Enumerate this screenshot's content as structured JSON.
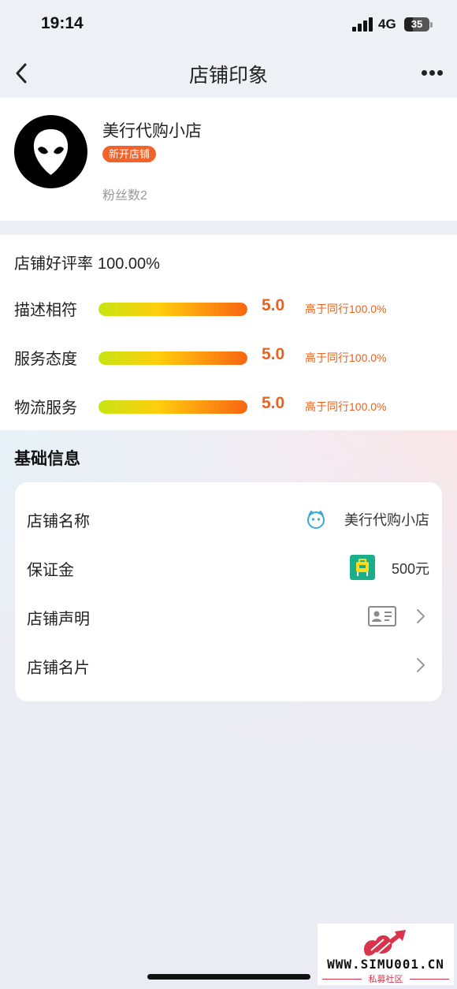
{
  "status_bar": {
    "time": "19:14",
    "network": "4G",
    "battery": "35",
    "battery_level": 0.35
  },
  "nav": {
    "title": "店铺印象",
    "back_icon": "chevron-left-icon",
    "more_icon": "more-dots-icon"
  },
  "shop": {
    "name": "美行代购小店",
    "badge": "新开店铺",
    "fans": "粉丝数2",
    "avatar_icon": "alien-head-icon"
  },
  "rating": {
    "label": "店铺好评率",
    "value": "100.00%",
    "metrics": [
      {
        "label": "描述相符",
        "score": "5.0",
        "compare": "高于同行100.0%",
        "fill": 1.0
      },
      {
        "label": "服务态度",
        "score": "5.0",
        "compare": "高于同行100.0%",
        "fill": 1.0
      },
      {
        "label": "物流服务",
        "score": "5.0",
        "compare": "高于同行100.0%",
        "fill": 1.0
      }
    ]
  },
  "basic_info": {
    "title": "基础信息",
    "rows": [
      {
        "label": "店铺名称",
        "value": "美行代购小店",
        "icon": "smiley-face-icon"
      },
      {
        "label": "保证金",
        "value": "500元",
        "icon": "deposit-bag-icon"
      },
      {
        "label": "店铺声明",
        "icon": "id-card-icon",
        "chevron": "chevron-right-icon"
      },
      {
        "label": "店铺名片",
        "chevron": "chevron-right-icon"
      }
    ]
  },
  "watermark": {
    "text": "WWW.SIMU001.CN",
    "subtext": "私募社区"
  },
  "colors": {
    "accent": "#e96320",
    "badge": "#f4622a",
    "deposit_icon": "#1aae8a",
    "link_icon": "#38a9d8"
  }
}
